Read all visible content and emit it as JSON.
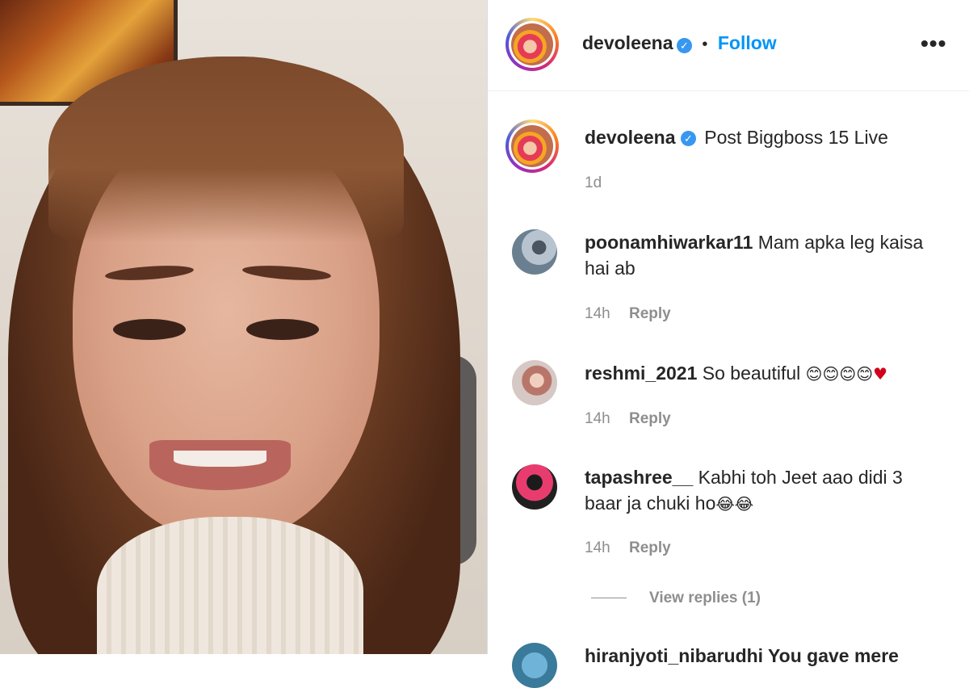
{
  "post": {
    "author": "devoleena",
    "follow_label": "Follow",
    "separator": "•",
    "more_icon": "more-options-icon",
    "verified_glyph": "✓"
  },
  "caption": {
    "author": "devoleena",
    "text": "Post Biggboss 15 Live",
    "time": "1d"
  },
  "comments": [
    {
      "user": "poonamhiwarkar11",
      "text_line1": "Mam apka leg kaisa",
      "text_line2": "hai ab",
      "time": "14h",
      "reply_label": "Reply"
    },
    {
      "user": "reshmi_2021",
      "text": "So beautiful",
      "emoji": "😊😊😊😊",
      "heart": "♥",
      "time": "14h",
      "reply_label": "Reply"
    },
    {
      "user": "tapashree__",
      "text_line1": "Kabhi toh Jeet aao didi 3",
      "text_line2": "baar ja chuki ho",
      "emoji": "😂😂",
      "time": "14h",
      "reply_label": "Reply"
    }
  ],
  "view_replies_label": "View replies (1)",
  "next_comment_partial": "hiranjyoti_nibarudhi You gave mere"
}
